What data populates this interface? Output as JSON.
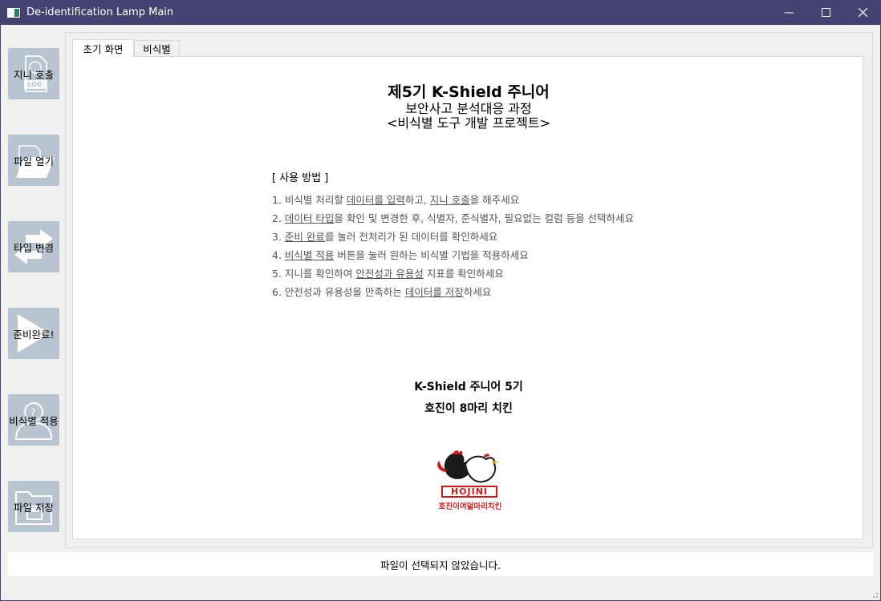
{
  "window": {
    "title": "De-identification Lamp Main",
    "minimize_glyph": "—",
    "maximize_glyph": "☐",
    "close_glyph": "✕"
  },
  "sidebar": {
    "items": [
      {
        "label": "지니 호출",
        "icon": "log-file-icon",
        "icon_text": "LOG"
      },
      {
        "label": "파일 열기",
        "icon": "open-folder-icon"
      },
      {
        "label": "타입 변경",
        "icon": "swap-arrows-icon"
      },
      {
        "label": "준비완료!",
        "icon": "play-icon"
      },
      {
        "label": "비식별 적용",
        "icon": "anonymous-user-icon"
      },
      {
        "label": "파일 저장",
        "icon": "save-folder-icon"
      }
    ]
  },
  "tabs": [
    {
      "label": "초기 화면",
      "active": true
    },
    {
      "label": "비식별",
      "active": false
    }
  ],
  "main": {
    "heading1": "제5기 K-Shield 주니어",
    "heading2": "보안사고 분석대응 과정",
    "heading3": "<비식별 도구 개발 프로젝트>",
    "usage_title": "[ 사용 방법 ]",
    "steps": [
      {
        "a": "1. 비식별 처리할 ",
        "u1": "데이터를 입력",
        "b": "하고, ",
        "u2": "지니 호출",
        "c": "을 해주세요"
      },
      {
        "a": "2. ",
        "u1": "데이터 타입",
        "b": "을 확인 및 변경한 후, 식별자, 준식별자, 필요없는 컬럼 등을 선택하세요",
        "u2": "",
        "c": ""
      },
      {
        "a": "3. ",
        "u1": "준비 완료",
        "b": "를 눌러 전처리가 된 데이터를 확인하세요",
        "u2": "",
        "c": ""
      },
      {
        "a": "4. ",
        "u1": "비식별 적용",
        "b": " 버튼을 눌러 원하는 비식별 기법을 적용하세요",
        "u2": "",
        "c": ""
      },
      {
        "a": "5. 지니를 확인하여 ",
        "u1": "안전성과 유용성",
        "b": " 지표를 확인하세요",
        "u2": "",
        "c": ""
      },
      {
        "a": "6. 안전성과 유용성을 만족하는 ",
        "u1": "데이터를 저장",
        "b": "하세요",
        "u2": "",
        "c": ""
      }
    ],
    "credit1": "K-Shield 주니어 5기",
    "credit2": "호진이 8마리 치킨",
    "logo_sign": "HOJINI",
    "logo_caption": "호진이여덟마리치킨"
  },
  "status": {
    "text": "파일이 선택되지 않았습니다."
  },
  "colors": {
    "titlebar": "#454170",
    "sidebar_button": "#b8c4d0",
    "logo_red": "#d01a1a"
  }
}
